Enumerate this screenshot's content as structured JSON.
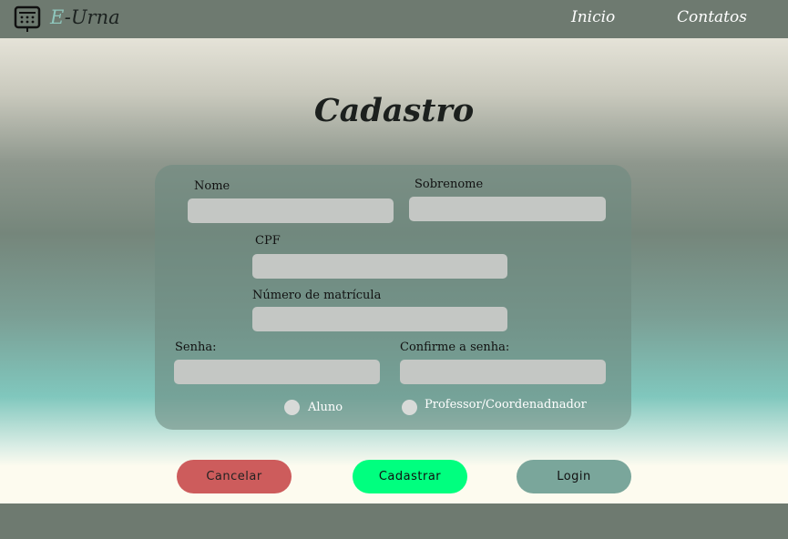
{
  "header": {
    "brand_prefix": "E",
    "brand_suffix": "-Urna",
    "nav": [
      "Inicio",
      "Contatos"
    ]
  },
  "page": {
    "title": "Cadastro"
  },
  "form": {
    "nome_label": "Nome",
    "sobrenome_label": "Sobrenome",
    "cpf_label": "CPF",
    "matricula_label": "Número de matrícula",
    "senha_label": "Senha:",
    "confirme_label": "Confirme a senha:",
    "radio_aluno": "Aluno",
    "radio_professor": "Professor/Coordenadnador"
  },
  "buttons": {
    "cancel": "Cancelar",
    "submit": "Cadastrar",
    "login": "Login"
  },
  "colors": {
    "topbar": "#6e7a70",
    "cancel": "#cd5c5c",
    "submit": "#00ff7f",
    "login": "#7aa69b"
  }
}
